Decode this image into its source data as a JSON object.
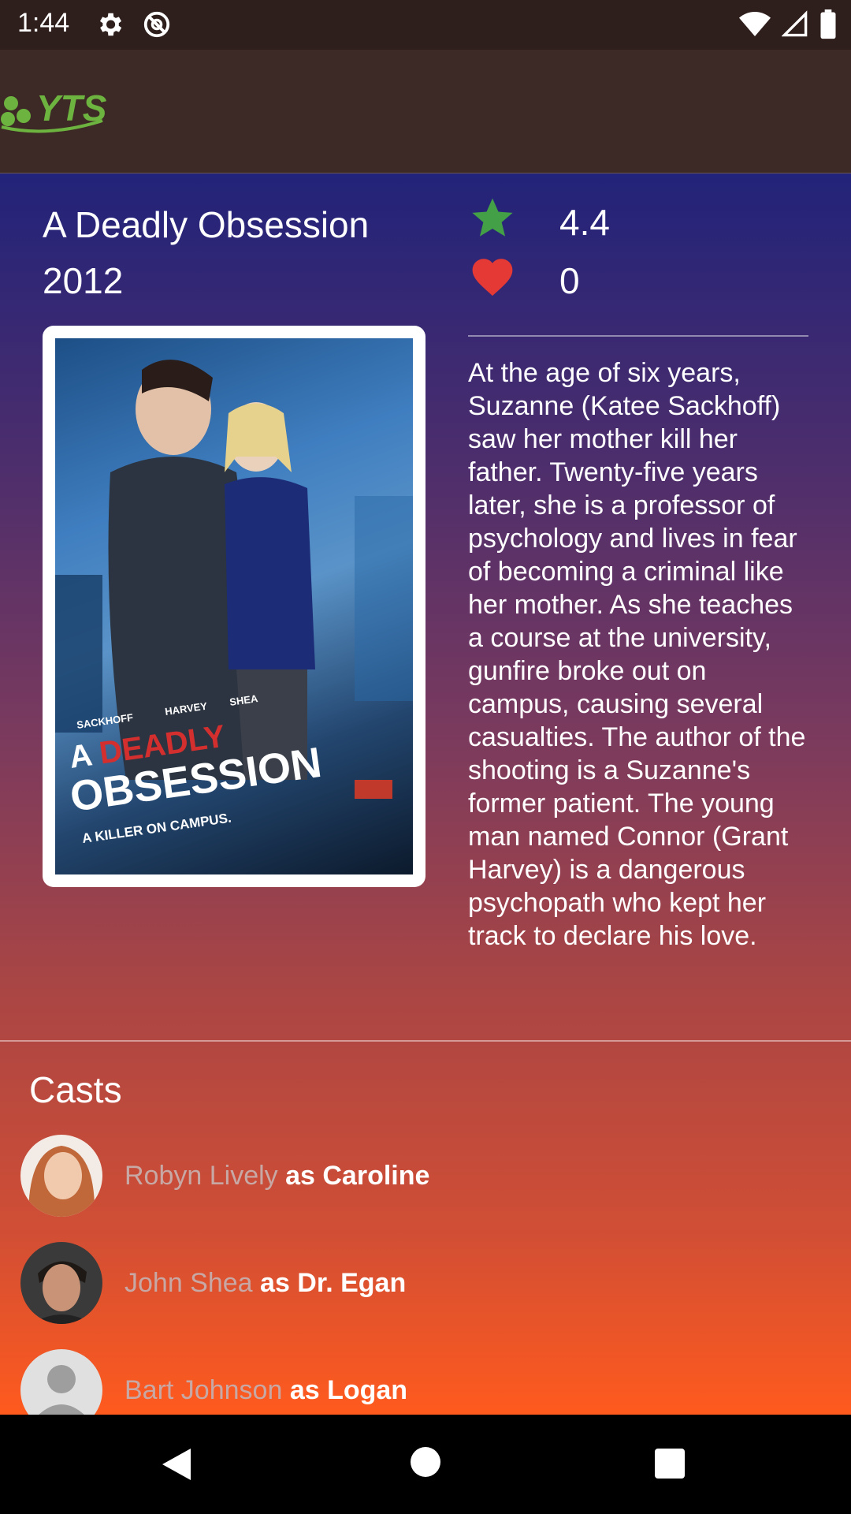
{
  "status_bar": {
    "time": "1:44"
  },
  "app_bar": {
    "logo_text": "YTS"
  },
  "movie": {
    "title": "A Deadly Obsession",
    "year": "2012",
    "rating": "4.4",
    "likes": "0",
    "synopsis": "At the age of six years, Suzanne (Katee Sackhoff) saw her mother kill her father. Twenty-five years later, she is a professor of psychology and lives in fear of becoming a criminal like her mother. As she teaches a course at the university, gunfire broke out on campus, causing several casualties. The author of the shooting is a Suzanne's former patient. The young man named Connor (Grant Harvey) is a dangerous psychopath who kept her track to declare his love.",
    "poster": {
      "credits": [
        "SACKHOFF",
        "HARVEY",
        "SHEA"
      ],
      "title_line1": "A DEADLY",
      "title_line2": "OBSESSION",
      "tagline": "A KILLER ON CAMPUS."
    }
  },
  "casts": {
    "heading": "Casts",
    "items": [
      {
        "actor": "Robyn Lively",
        "role": "as Caroline"
      },
      {
        "actor": "John Shea",
        "role": "as Dr. Egan"
      },
      {
        "actor": "Bart Johnson",
        "role": "as Logan"
      }
    ]
  },
  "colors": {
    "status_bar": "#2f1f1c",
    "app_bar": "#3d2925",
    "logo_green": "#6db33f",
    "star": "#43a047",
    "heart": "#e53935"
  }
}
